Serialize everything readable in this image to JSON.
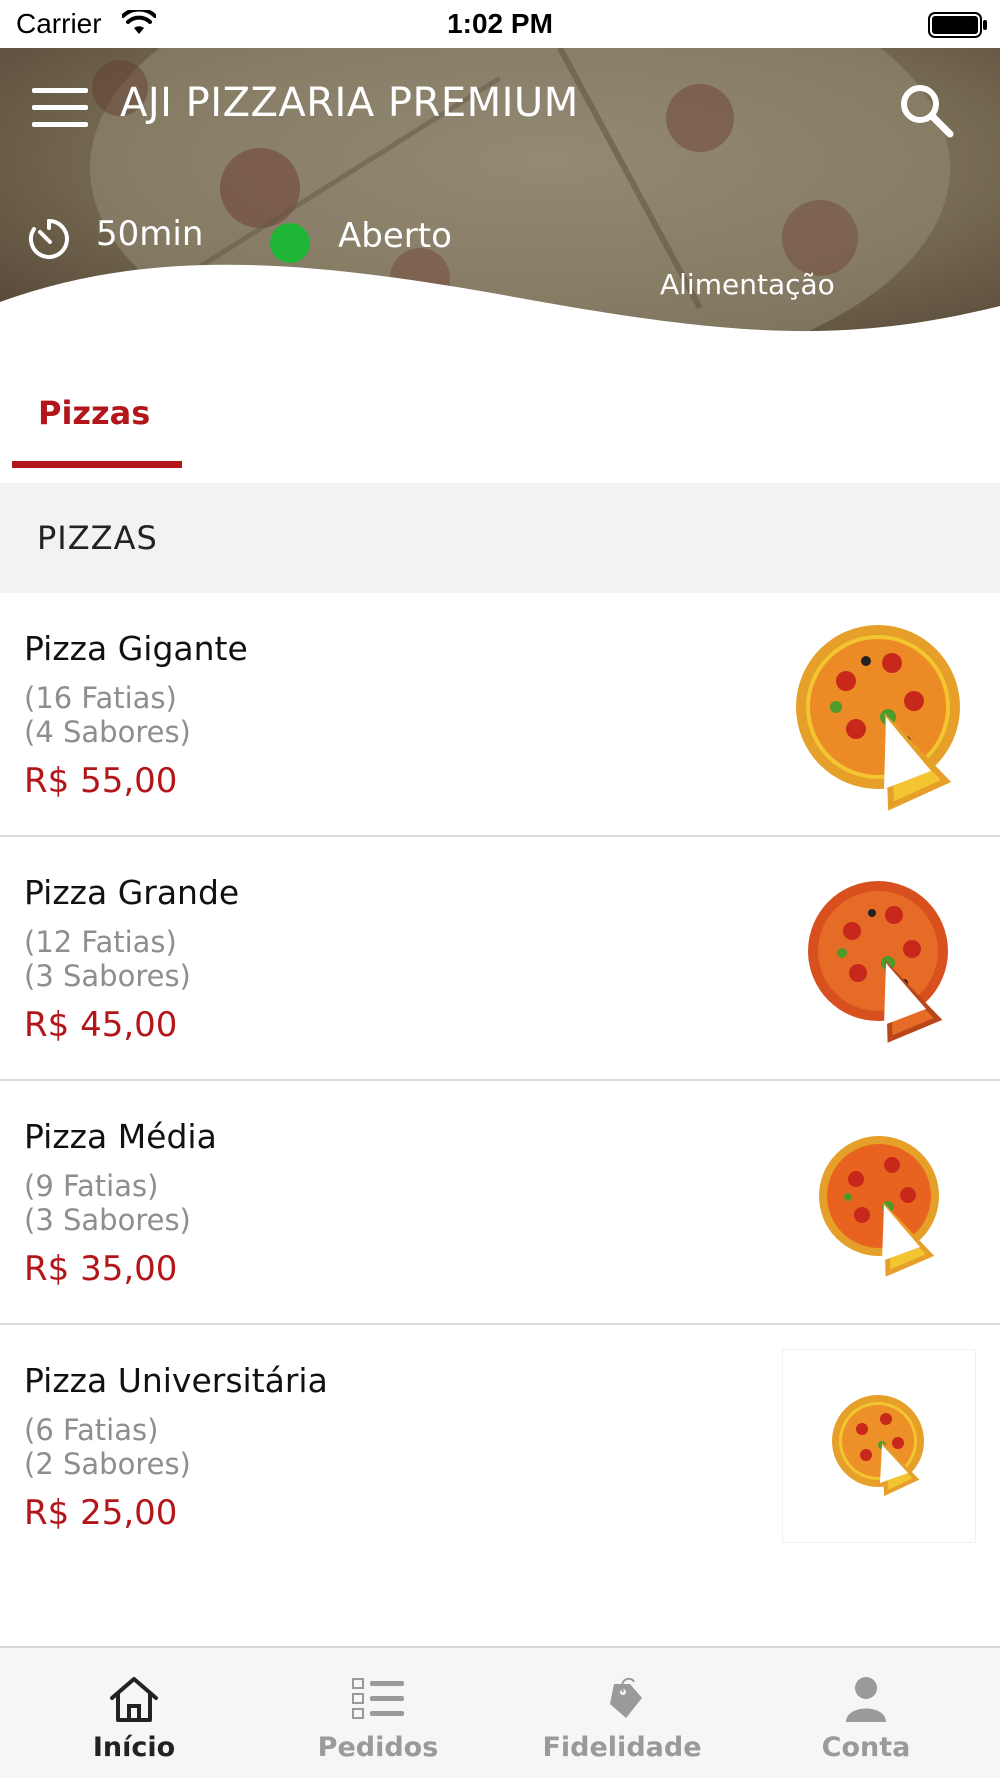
{
  "status_bar": {
    "carrier": "Carrier",
    "time": "1:02 PM"
  },
  "header": {
    "title": "AJI PIZZARIA PREMIUM",
    "delivery_time": "50min",
    "status": "Aberto",
    "category": "Alimentação",
    "status_color": "#1fb536"
  },
  "tabs": [
    {
      "label": "Pizzas",
      "active": true
    }
  ],
  "section": {
    "title": "PIZZAS"
  },
  "products": [
    {
      "name": "Pizza Gigante",
      "slices": "(16 Fatias)",
      "flavors": "(4 Sabores)",
      "price": "R$ 55,00"
    },
    {
      "name": "Pizza Grande",
      "slices": "(12 Fatias)",
      "flavors": "(3 Sabores)",
      "price": "R$ 45,00"
    },
    {
      "name": "Pizza Média",
      "slices": "(9 Fatias)",
      "flavors": "(3 Sabores)",
      "price": "R$ 35,00"
    },
    {
      "name": "Pizza Universitária",
      "slices": "(6 Fatias)",
      "flavors": "(2 Sabores)",
      "price": "R$ 25,00"
    }
  ],
  "bottom_nav": [
    {
      "label": "Início",
      "icon": "home-icon",
      "active": true
    },
    {
      "label": "Pedidos",
      "icon": "checklist-icon",
      "active": false
    },
    {
      "label": "Fidelidade",
      "icon": "tag-icon",
      "active": false
    },
    {
      "label": "Conta",
      "icon": "user-icon",
      "active": false
    }
  ],
  "colors": {
    "accent": "#b3161a",
    "muted": "#8e8e8e",
    "section_bg": "#f2f2f2"
  }
}
